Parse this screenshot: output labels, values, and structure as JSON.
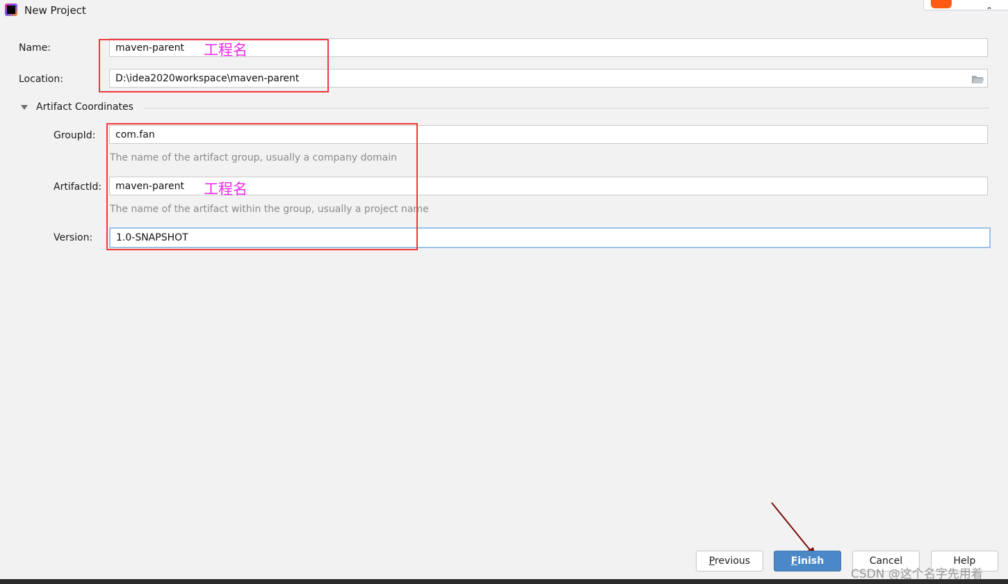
{
  "window": {
    "title": "New Project",
    "icon": "intellij-idea-icon"
  },
  "form": {
    "name": {
      "label": "Name:",
      "value": "maven-parent"
    },
    "location": {
      "label": "Location:",
      "value": "D:\\idea2020workspace\\maven-parent",
      "browse_icon": "folder-icon"
    },
    "section": {
      "title": "Artifact Coordinates",
      "expanded": true
    },
    "group_id": {
      "label": "GroupId:",
      "value": "com.fan",
      "hint": "The name of the artifact group, usually a company domain"
    },
    "artifact_id": {
      "label": "ArtifactId:",
      "value": "maven-parent",
      "hint": "The name of the artifact within the group, usually a project name"
    },
    "version": {
      "label": "Version:",
      "value": "1.0-SNAPSHOT"
    }
  },
  "annotations": {
    "project_name_1": "工程名",
    "project_name_2": "工程名",
    "color": "#f028f0",
    "box_color": "#f0363a"
  },
  "buttons": {
    "previous": {
      "mnemonic": "P",
      "rest": "revious"
    },
    "finish": {
      "mnemonic": "F",
      "rest": "inish"
    },
    "cancel": "Cancel",
    "help": "Help"
  },
  "accent": "#4a88c7",
  "watermark": "CSDN @这个名字先用着"
}
